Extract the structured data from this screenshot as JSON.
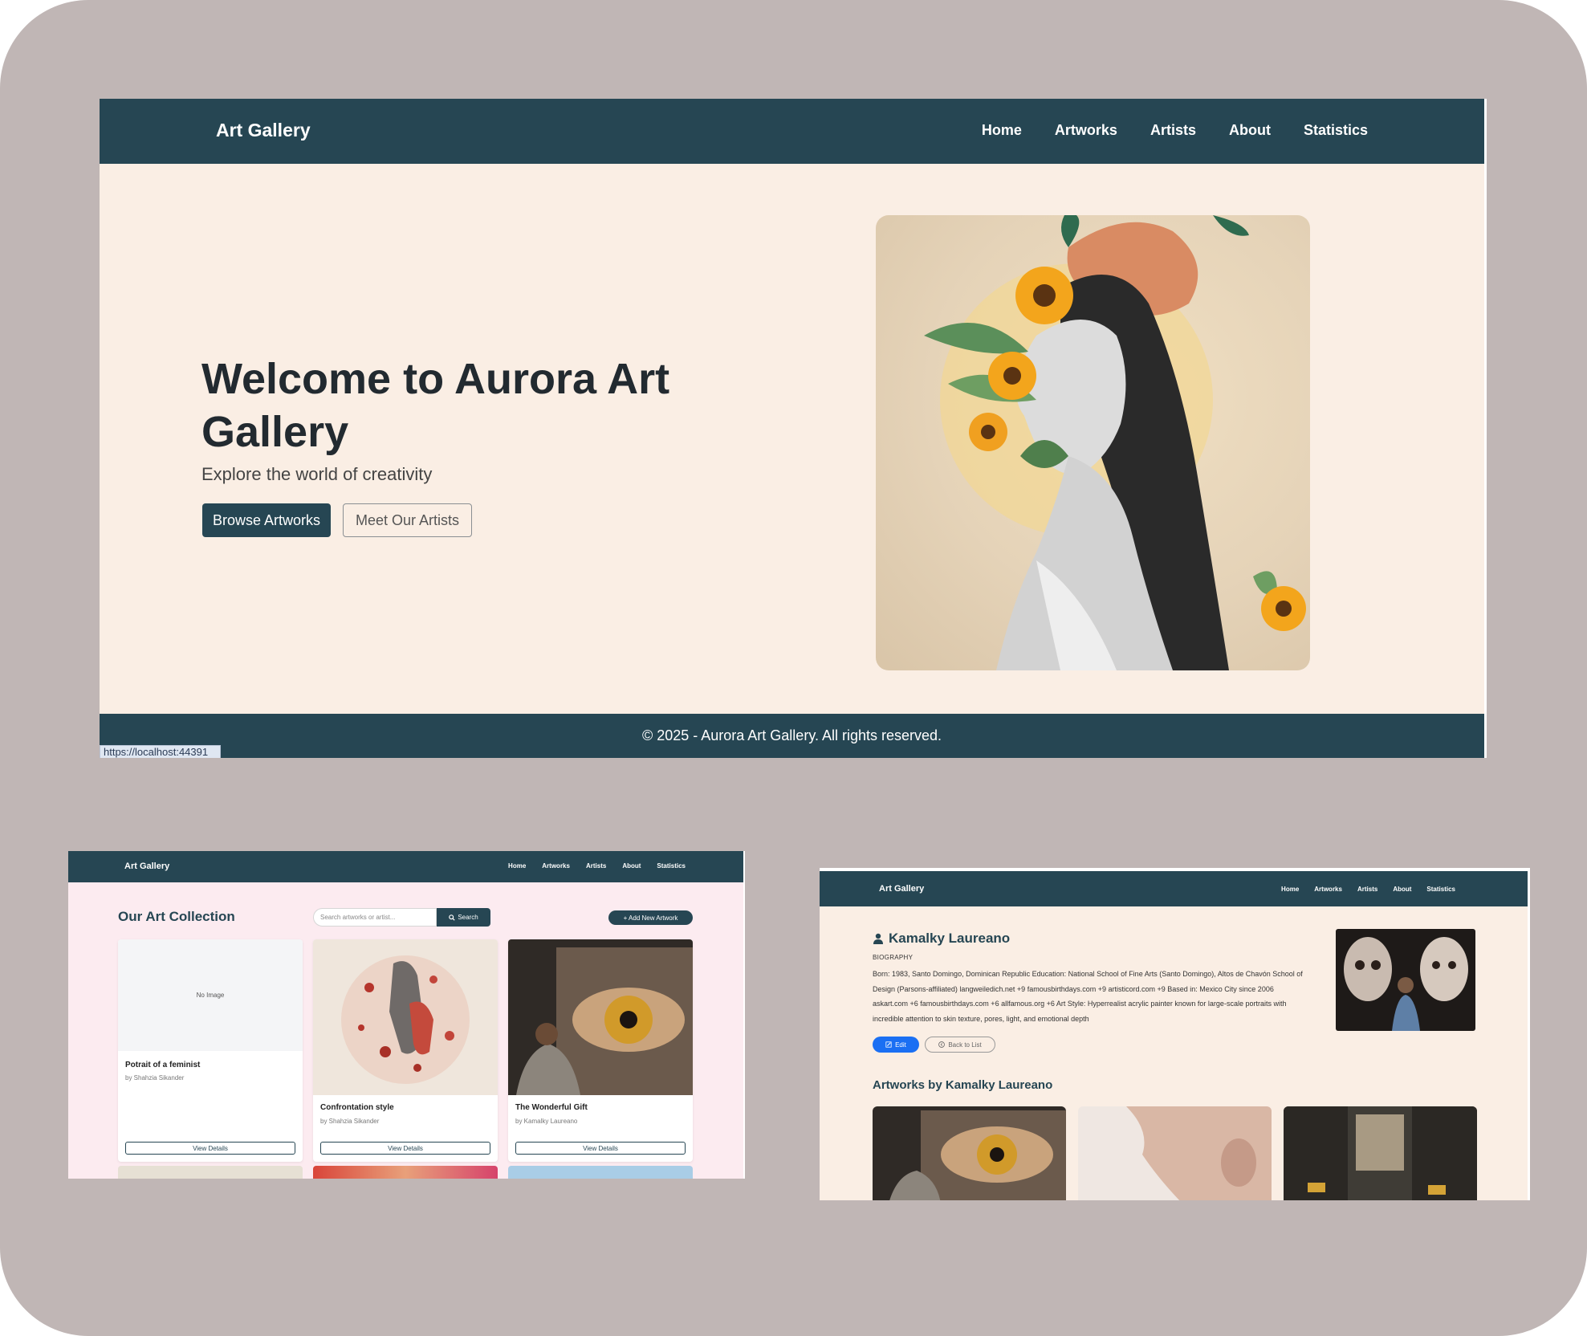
{
  "colors": {
    "navy": "#264653",
    "cream": "#faeee4",
    "pink": "#fcebf0",
    "frame": "#c0b6b5",
    "edit_blue": "#1a6ff3"
  },
  "home": {
    "brand": "Art Gallery",
    "nav": [
      "Home",
      "Artworks",
      "Artists",
      "About",
      "Statistics"
    ],
    "hero_title": "Welcome to Aurora Art Gallery",
    "hero_subtitle": "Explore the world of creativity",
    "btn_browse": "Browse Artworks",
    "btn_artists": "Meet Our Artists",
    "footer": "© 2025 - Aurora Art Gallery. All rights reserved.",
    "status_url": "https://localhost:44391"
  },
  "collection": {
    "brand": "Art Gallery",
    "nav": [
      "Home",
      "Artworks",
      "Artists",
      "About",
      "Statistics"
    ],
    "title": "Our Art Collection",
    "search_placeholder": "Search artworks or artist...",
    "search_button": "Search",
    "add_button": "+ Add New Artwork",
    "cards": [
      {
        "no_image": "No Image",
        "title": "Potrait of a feminist",
        "by": "by Shahzia Sikander",
        "button": "View Details"
      },
      {
        "title": "Confrontation style",
        "by": "by Shahzia Sikander",
        "button": "View Details"
      },
      {
        "title": "The Wonderful Gift",
        "by": "by Kamalky Laureano",
        "button": "View Details"
      }
    ]
  },
  "artist": {
    "brand": "Art Gallery",
    "nav": [
      "Home",
      "Artworks",
      "Artists",
      "About",
      "Statistics"
    ],
    "name": "Kamalky Laureano",
    "bio_label": "BIOGRAPHY",
    "bio": "Born: 1983, Santo Domingo, Dominican Republic Education: National School of Fine Arts (Santo Domingo), Altos de Chavón School of Design (Parsons-affiliated) langweiledich.net +9 famousbirthdays.com +9 artisticord.com +9 Based in: Mexico City since 2006 askart.com +6 famousbirthdays.com +6 allfamous.org +6 Art Style: Hyperrealist acrylic painter known for large-scale portraits with incredible attention to skin texture, pores, light, and emotional depth",
    "edit_button": "Edit",
    "back_button": "Back to List",
    "section_title": "Artworks by Kamalky Laureano"
  },
  "icons": [
    "user-icon",
    "search-icon",
    "edit-icon",
    "back-arrow-icon"
  ]
}
